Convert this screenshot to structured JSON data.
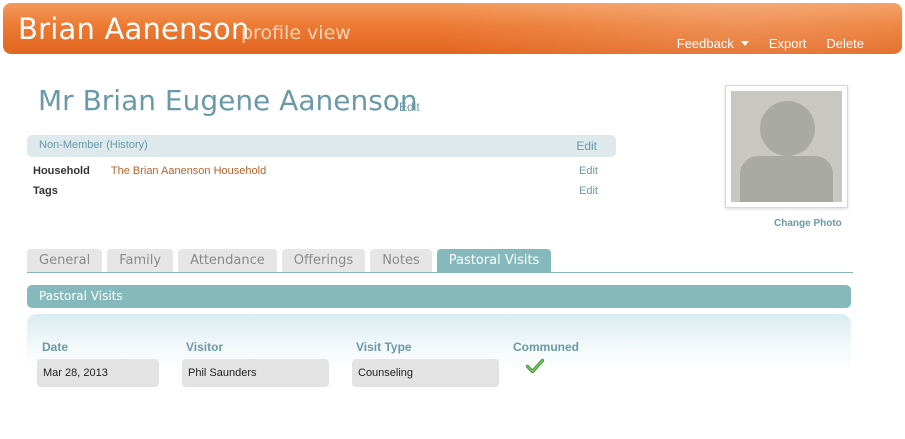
{
  "header": {
    "name": "Brian Aanenson",
    "subtitle": "profile view",
    "actions": {
      "feedback": "Feedback",
      "export": "Export",
      "delete": "Delete"
    }
  },
  "profile": {
    "full_name": "Mr Brian Eugene Aanenson",
    "edit_label": "Edit",
    "status": "Non-Member (History)",
    "status_edit": "Edit",
    "household_label": "Household",
    "household_value": "The Brian Aanenson Household",
    "household_edit": "Edit",
    "tags_label": "Tags",
    "tags_edit": "Edit",
    "change_photo": "Change Photo"
  },
  "tabs": [
    {
      "label": "General"
    },
    {
      "label": "Family"
    },
    {
      "label": "Attendance"
    },
    {
      "label": "Offerings"
    },
    {
      "label": "Notes"
    },
    {
      "label": "Pastoral Visits",
      "active": true
    }
  ],
  "section": {
    "title": "Pastoral Visits"
  },
  "table": {
    "columns": [
      "Date",
      "Visitor",
      "Visit Type",
      "Communed"
    ],
    "rows": [
      {
        "date": "Mar 28, 2013",
        "visitor": "Phil Saunders",
        "visit_type": "Counseling",
        "communed": true
      }
    ]
  },
  "colors": {
    "accent": "#86b9bc",
    "banner": "#ec7a33",
    "link": "#b5632d",
    "check": "#4caf30"
  },
  "icons": {
    "feedback_caret": "chevron-down-icon",
    "communed": "checkmark-icon",
    "photo": "avatar-placeholder-icon"
  }
}
